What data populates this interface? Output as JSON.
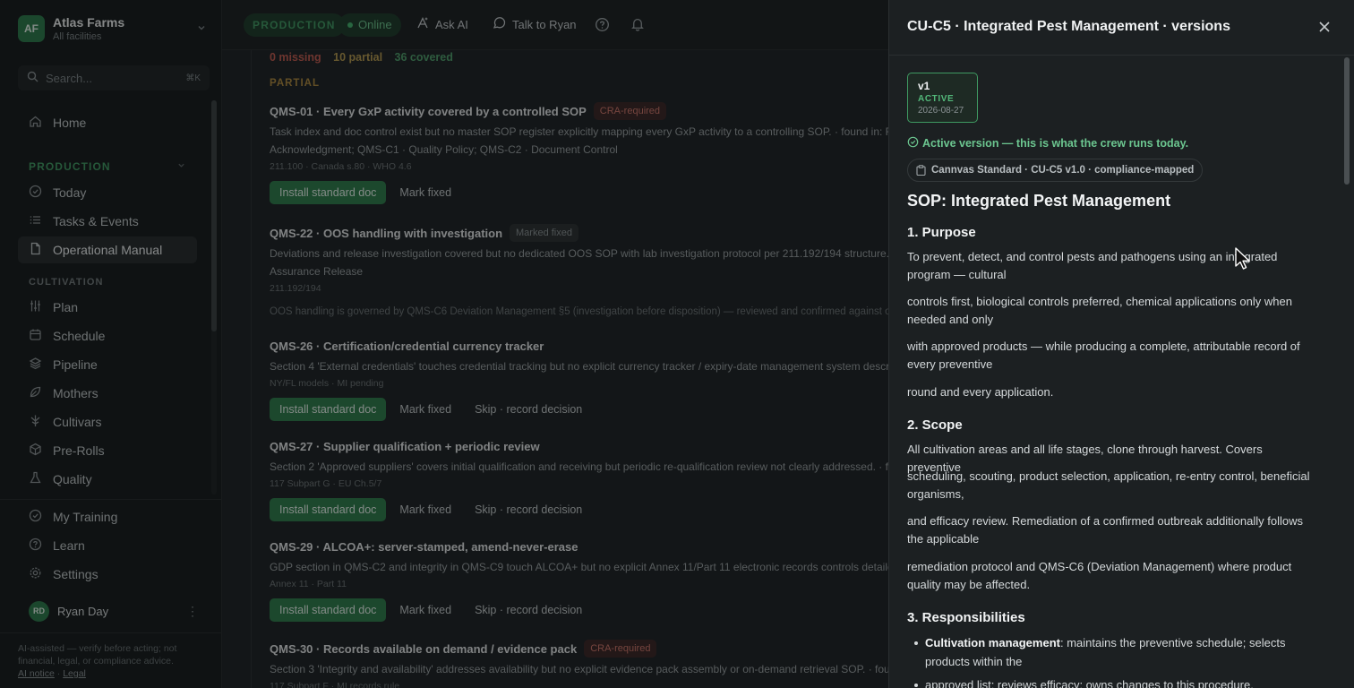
{
  "org": {
    "initials": "AF",
    "name": "Atlas Farms",
    "scope": "All facilities"
  },
  "search": {
    "placeholder": "Search...",
    "shortcut": "⌘K"
  },
  "sidebar": {
    "home": "Home",
    "production_section": "PRODUCTION",
    "production_items": [
      "Today",
      "Tasks & Events",
      "Operational Manual"
    ],
    "cultivation_section": "CULTIVATION",
    "cultivation_items": [
      "Plan",
      "Schedule",
      "Pipeline",
      "Mothers",
      "Cultivars",
      "Pre-Rolls",
      "Quality"
    ],
    "footer_items": [
      "My Training",
      "Learn",
      "Settings"
    ],
    "active_item": "Operational Manual"
  },
  "user": {
    "initials": "RD",
    "name": "Ryan Day"
  },
  "disclaimer": {
    "text": "AI-assisted — verify before acting; not financial, legal, or compliance advice.",
    "ai_notice": "AI notice",
    "separator": "·",
    "legal": "Legal"
  },
  "topbar": {
    "mode": "PRODUCTION",
    "status": "Online",
    "ask_ai": "Ask AI",
    "talk": "Talk to Ryan"
  },
  "summary": {
    "missing": "0 missing",
    "partial": "10 partial",
    "covered": "36 covered"
  },
  "partial_label": "PARTIAL",
  "gaps": [
    {
      "title": "QMS-01 · Every GxP activity covered by a controlled SOP",
      "badge": "CRA-required",
      "desc": "Task index and doc control exist but no master SOP register explicitly mapping every GxP activity to a controlling SOP. · found in: FM-0",
      "desc2": "Acknowledgment; QMS-C1 · Quality Policy; QMS-C2 · Document Control",
      "refs": "211.100 · Canada s.80 · WHO 4.6",
      "actions": [
        "Install standard doc",
        "Mark fixed"
      ]
    },
    {
      "title": "QMS-22 · OOS handling with investigation",
      "badge": "Marked fixed",
      "desc": "Deviations and release investigation covered but no dedicated OOS SOP with lab investigation protocol per 211.192/194 structure. · fo",
      "desc2": "Assurance Release",
      "refs": "211.192/194",
      "note": "OOS handling is governed by QMS-C6 Deviation Management §5 (investigation before disposition) — reviewed and confirmed against our lab"
    },
    {
      "title": "QMS-26 · Certification/credential currency tracker",
      "desc": "Section 4 'External credentials' touches credential tracking but no explicit currency tracker / expiry-date management system describe",
      "refs": "NY/FL models · MI pending",
      "actions": [
        "Install standard doc",
        "Mark fixed",
        "Skip · record decision"
      ]
    },
    {
      "title": "QMS-27 · Supplier qualification + periodic review",
      "desc": "Section 2 'Approved suppliers' covers initial qualification and receiving but periodic re-qualification review not clearly addressed. · foun",
      "refs": "117 Subpart G · EU Ch.5/7",
      "actions": [
        "Install standard doc",
        "Mark fixed",
        "Skip · record decision"
      ]
    },
    {
      "title": "QMS-29 · ALCOA+: server-stamped, amend-never-erase",
      "desc": "GDP section in QMS-C2 and integrity in QMS-C9 touch ALCOA+ but no explicit Annex 11/Part 11 electronic records controls detailed.",
      "refs": "Annex 11 · Part 11",
      "actions": [
        "Install standard doc",
        "Mark fixed",
        "Skip · record decision"
      ]
    },
    {
      "title": "QMS-30 · Records available on demand / evidence pack",
      "badge": "CRA-required",
      "desc": "Section 3 'Integrity and availability' addresses availability but no explicit evidence pack assembly or on-demand retrieval SOP. · found in",
      "refs": "117 Subpart F · MI records rule"
    }
  ],
  "drawer": {
    "title": "CU-C5 · Integrated Pest Management · versions",
    "version": {
      "number": "v1",
      "status": "ACTIVE",
      "date": "2026-08-27"
    },
    "active_note": "Active version — this is what the crew runs today.",
    "source_chip": "Cannvas Standard · CU-C5 v1.0 · compliance-mapped",
    "doc_title": "SOP: Integrated Pest Management",
    "h_purpose": "1. Purpose",
    "purpose": [
      "To prevent, detect, and control pests and pathogens using an integrated program — cultural",
      "controls first, biological controls preferred, chemical applications only when needed and only",
      "with approved products — while producing a complete, attributable record of every preventive",
      "round and every application."
    ],
    "h_scope": "2. Scope",
    "scope": [
      "All cultivation areas and all life stages, clone through harvest. Covers preventive",
      "scheduling, scouting, product selection, application, re-entry control, beneficial organisms,",
      "and efficacy review. Remediation of a confirmed outbreak additionally follows the applicable",
      "remediation protocol and QMS-C6 (Deviation Management) where product quality may be affected."
    ],
    "h_resp": "3. Responsibilities",
    "resp_1_lead": "Cultivation management",
    "resp_1_text": ": maintains the preventive schedule; selects products within the",
    "resp_2": "approved list; reviews efficacy; owns changes to this procedure."
  },
  "colors": {
    "accent_green": "#2e7d4b",
    "cra_red": "#d2776b",
    "partial_amber": "#b79a4e"
  }
}
